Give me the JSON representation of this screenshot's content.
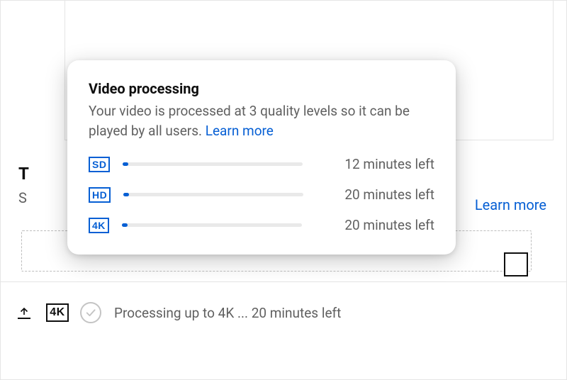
{
  "popup": {
    "title": "Video processing",
    "description": "Your video is processed at 3 quality levels so it can be played by all users.",
    "learn_more": "Learn more",
    "levels": [
      {
        "label": "SD",
        "progress_pct": 3,
        "eta": "12 minutes left"
      },
      {
        "label": "HD",
        "progress_pct": 3,
        "eta": "20 minutes left"
      },
      {
        "label": "4K",
        "progress_pct": 3,
        "eta": "20 minutes left"
      }
    ]
  },
  "background": {
    "heading_partial": "T",
    "sub_partial": "S",
    "learn_more": "Learn more"
  },
  "status_bar": {
    "quality_badge": "4K",
    "text": "Processing up to 4K ... 20 minutes left"
  }
}
